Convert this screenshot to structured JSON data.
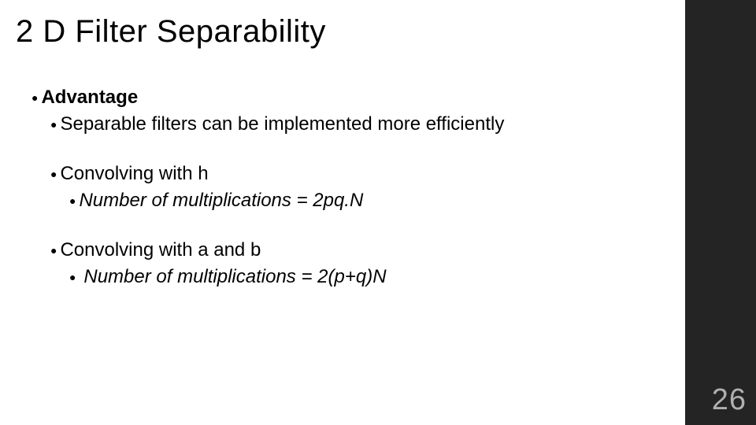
{
  "title": "2 D Filter Separability",
  "content": {
    "advantage_label": "Advantage",
    "separable_line": "Separable filters can be implemented more efficiently",
    "conv_h_line": "Convolving with h",
    "conv_h_mult": "Number of multiplications =  2pq.N",
    "conv_ab_line": "Convolving with a and b",
    "conv_ab_mult": "Number of multiplications =  2(p+q)N"
  },
  "page_number": "26"
}
